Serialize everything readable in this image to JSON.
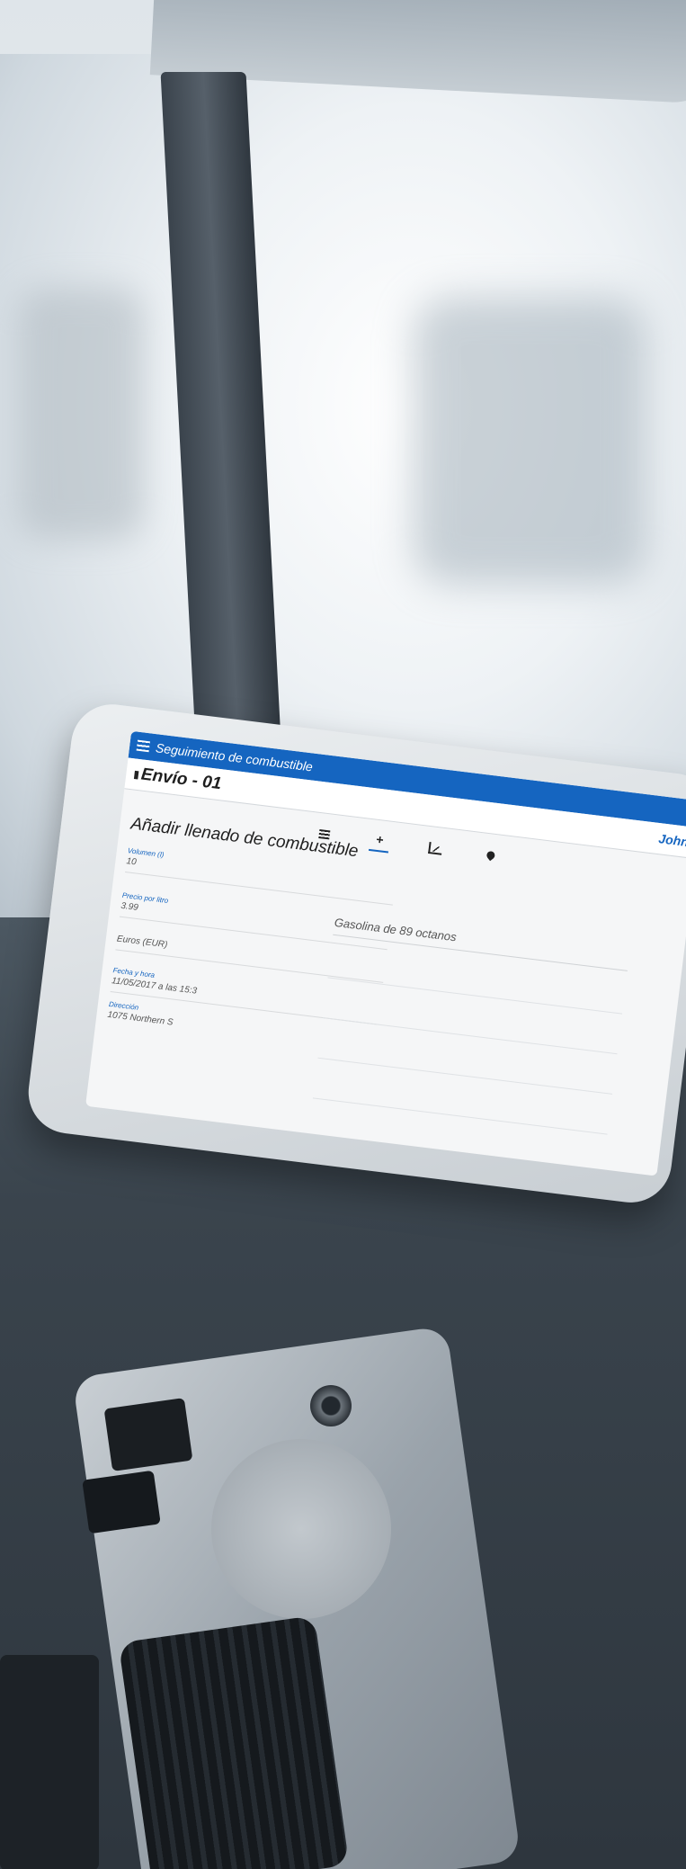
{
  "app": {
    "title": "Seguimiento de combustible",
    "shipment": "Envío - 01",
    "user": "John"
  },
  "tabs": [
    {
      "icon": "list-icon",
      "label": ""
    },
    {
      "icon": "plus-icon",
      "label": "+",
      "active": true
    },
    {
      "icon": "chart-icon",
      "label": ""
    },
    {
      "icon": "location-pin-icon",
      "label": ""
    }
  ],
  "form": {
    "heading": "Añadir llenado de combustible",
    "volume": {
      "label": "Volumen (l)",
      "value": "10"
    },
    "price": {
      "label": "Precio por litro",
      "value": "3.99"
    },
    "currency": {
      "value": "Euros (EUR)"
    },
    "datetime": {
      "label": "Fecha y hora",
      "value": "11/05/2017 a las 15:3"
    },
    "address": {
      "label": "Dirección",
      "value": "1075 Northern S"
    },
    "fuel_type": "Gasolina de 89 octanos"
  },
  "colors": {
    "app_bar": "#1565c0",
    "accent": "#1565c0"
  }
}
